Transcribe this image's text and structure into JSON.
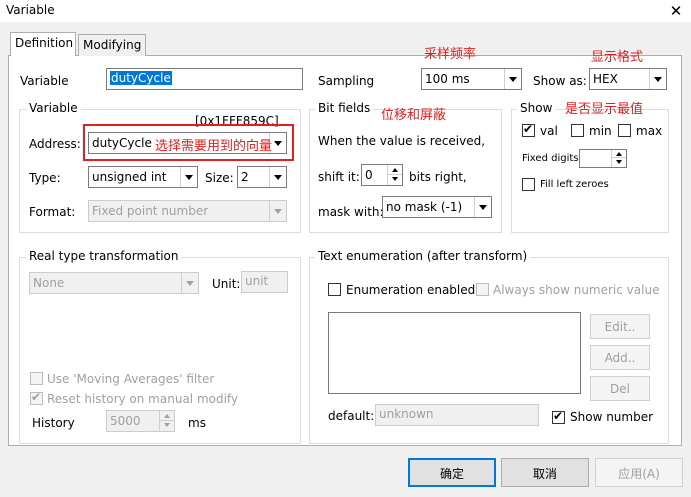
{
  "window": {
    "title": "Variable",
    "close_symbol": "✕"
  },
  "tabs": [
    {
      "label": "Definition"
    },
    {
      "label": "Modifying"
    }
  ],
  "variable_row": {
    "label": "Variable",
    "value": "dutyCycle"
  },
  "sampling": {
    "label": "Sampling",
    "value": "100 ms"
  },
  "show_as": {
    "label": "Show as:",
    "value": "HEX"
  },
  "variable_group": {
    "title": "Variable",
    "address_hex": "[0x1FFF859C]",
    "address_label": "Address:",
    "address_value": "dutyCycle",
    "type_label": "Type:",
    "type_value": "unsigned int",
    "size_label": "Size:",
    "size_value": "2",
    "format_label": "Format:",
    "format_value": "Fixed point number"
  },
  "bit_fields": {
    "title": "Bit fields",
    "when_text": "When the value is received,",
    "shift_label": "shift it:",
    "shift_value": "0",
    "bits_right": "bits right,",
    "mask_label": "mask with:",
    "mask_value": "no mask (-1)"
  },
  "show_group": {
    "title": "Show",
    "val_label": "val",
    "min_label": "min",
    "max_label": "max",
    "fixed_digits_label": "Fixed digits:",
    "fill_left_label": "Fill left zeroes"
  },
  "real_type": {
    "title": "Real type transformation",
    "value": "None",
    "unit_label": "Unit:",
    "unit_placeholder": "unit",
    "moving_avg_label": "Use 'Moving Averages' filter",
    "reset_history_label": "Reset history on manual modify",
    "history_label": "History",
    "history_value": "5000",
    "history_unit": "ms"
  },
  "text_enum": {
    "title": "Text enumeration (after transform)",
    "enabled_label": "Enumeration enabled",
    "always_show_label": "Always show numeric value",
    "edit_button": "Edit..",
    "add_button": "Add..",
    "del_button": "Del",
    "default_label": "default:",
    "default_placeholder": "unknown",
    "show_number_label": "Show number"
  },
  "annotations": {
    "sampling_rate": "采样频率",
    "display_format": "显示格式",
    "shift_mask": "位移和屏蔽",
    "show_extreme": "是否显示最值",
    "select_variable": "选择需要用到的向量"
  },
  "footer": {
    "ok": "确定",
    "cancel": "取消",
    "apply": "应用(A)"
  },
  "colors": {
    "annotation": "#e02020",
    "selection": "#0078d7"
  }
}
